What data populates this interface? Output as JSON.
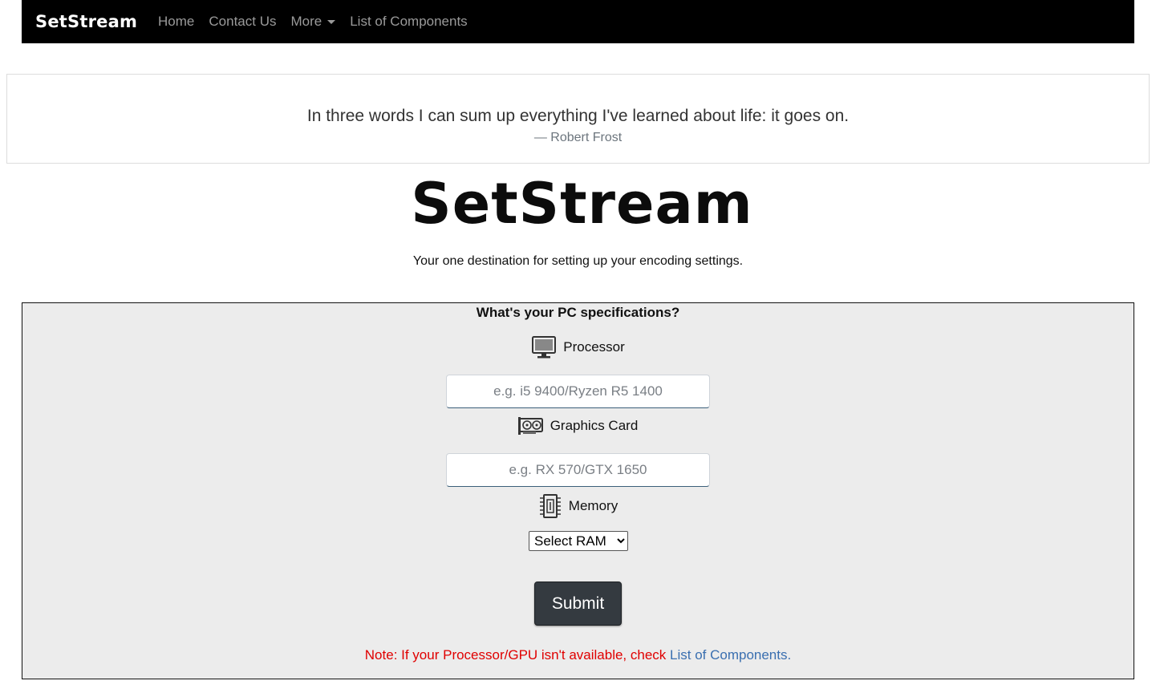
{
  "navbar": {
    "brand": "SetStream",
    "links": [
      {
        "label": "Home"
      },
      {
        "label": "Contact Us"
      },
      {
        "label": "More"
      },
      {
        "label": "List of Components"
      }
    ]
  },
  "quote": {
    "text": "In three words I can sum up everything I've learned about life: it goes on.",
    "author": "— Robert Frost"
  },
  "hero": {
    "logo_text": "SetStream",
    "tagline": "Your one destination for setting up your encoding settings."
  },
  "form": {
    "heading": "What's your PC specifications?",
    "processor": {
      "label": "Processor",
      "icon": "monitor-icon",
      "placeholder": "e.g. i5 9400/Ryzen R5 1400",
      "value": ""
    },
    "gpu": {
      "label": "Graphics Card",
      "icon": "graphics-card-icon",
      "placeholder": "e.g. RX 570/GTX 1650",
      "value": ""
    },
    "memory": {
      "label": "Memory",
      "icon": "memory-chip-icon",
      "selected": "Select RAM"
    },
    "submit_label": "Submit",
    "note_text": "Note: If your Processor/GPU isn't available, check ",
    "note_link": "List of Components."
  },
  "colors": {
    "navbar_bg": "#000000",
    "panel_bg": "#ececec",
    "button_bg": "#343a40",
    "note_red": "#e00000",
    "link_blue": "#3a6fb0"
  }
}
